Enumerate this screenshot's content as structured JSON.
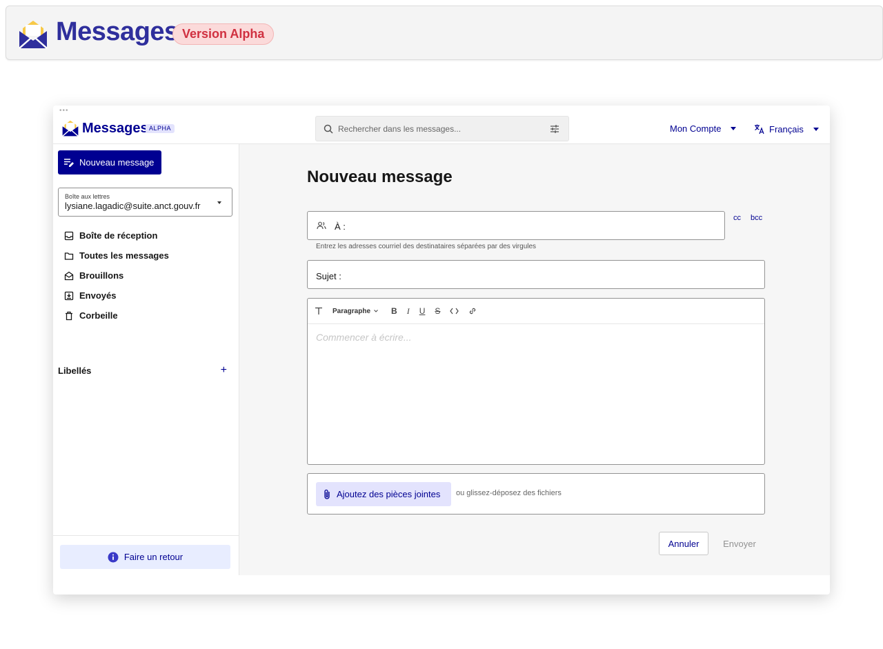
{
  "banner": {
    "title": "Messages",
    "badge": "Version Alpha"
  },
  "header": {
    "title": "Messages",
    "badge": "ALPHA",
    "search_placeholder": "Rechercher dans les messages...",
    "account_label": "Mon Compte",
    "language_label": "Français"
  },
  "sidebar": {
    "new_message_label": "Nouveau message",
    "mailbox": {
      "label": "Boîte aux lettres",
      "value": "lysiane.lagadic@suite.anct.gouv.fr"
    },
    "folders": [
      {
        "label": "Boîte de réception",
        "icon": "inbox-icon"
      },
      {
        "label": "Toutes les messages",
        "icon": "folder-icon"
      },
      {
        "label": "Brouillons",
        "icon": "drafts-icon"
      },
      {
        "label": "Envoyés",
        "icon": "sent-icon"
      },
      {
        "label": "Corbeille",
        "icon": "trash-icon"
      }
    ],
    "labels_title": "Libellés",
    "labels_add": "+",
    "feedback_label": "Faire un retour"
  },
  "compose": {
    "title": "Nouveau message",
    "to_label": "À :",
    "cc_label": "cc",
    "bcc_label": "bcc",
    "to_hint": "Entrez les adresses courriel des destinataires séparées par des virgules",
    "subject_label": "Sujet :",
    "toolbar": {
      "paragraph_label": "Paragraphe",
      "bold": "B",
      "italic": "I",
      "underline": "U",
      "strike": "S"
    },
    "body_placeholder": "Commencer à écrire...",
    "attach_label": "Ajoutez des pièces jointes",
    "attach_hint": "ou glissez-déposez des fichiers",
    "cancel_label": "Annuler",
    "send_label": "Envoyer"
  },
  "colors": {
    "brand": "#000091",
    "banner_title": "#2f2f9c",
    "alpha_badge_text": "#d03040",
    "alpha_badge_bg": "#fbdada",
    "logo_yellow": "#f7c948",
    "main_bg": "#f6f6f6"
  }
}
